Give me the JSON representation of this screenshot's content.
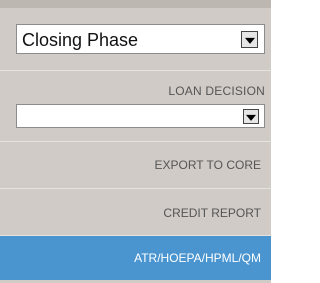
{
  "phase_select": {
    "value": "Closing Phase"
  },
  "loan_decision": {
    "label": "LOAN DECISION",
    "value": ""
  },
  "menu": {
    "items": [
      {
        "label": "EXPORT TO CORE",
        "active": false
      },
      {
        "label": "CREDIT REPORT",
        "active": false
      },
      {
        "label": "ATR/HOEPA/HPML/QM",
        "active": true
      }
    ]
  },
  "colors": {
    "panel_background": "#d0cbc7",
    "active_item_background": "#4a95cf",
    "active_item_text": "#ffffff",
    "item_text": "#555555"
  }
}
